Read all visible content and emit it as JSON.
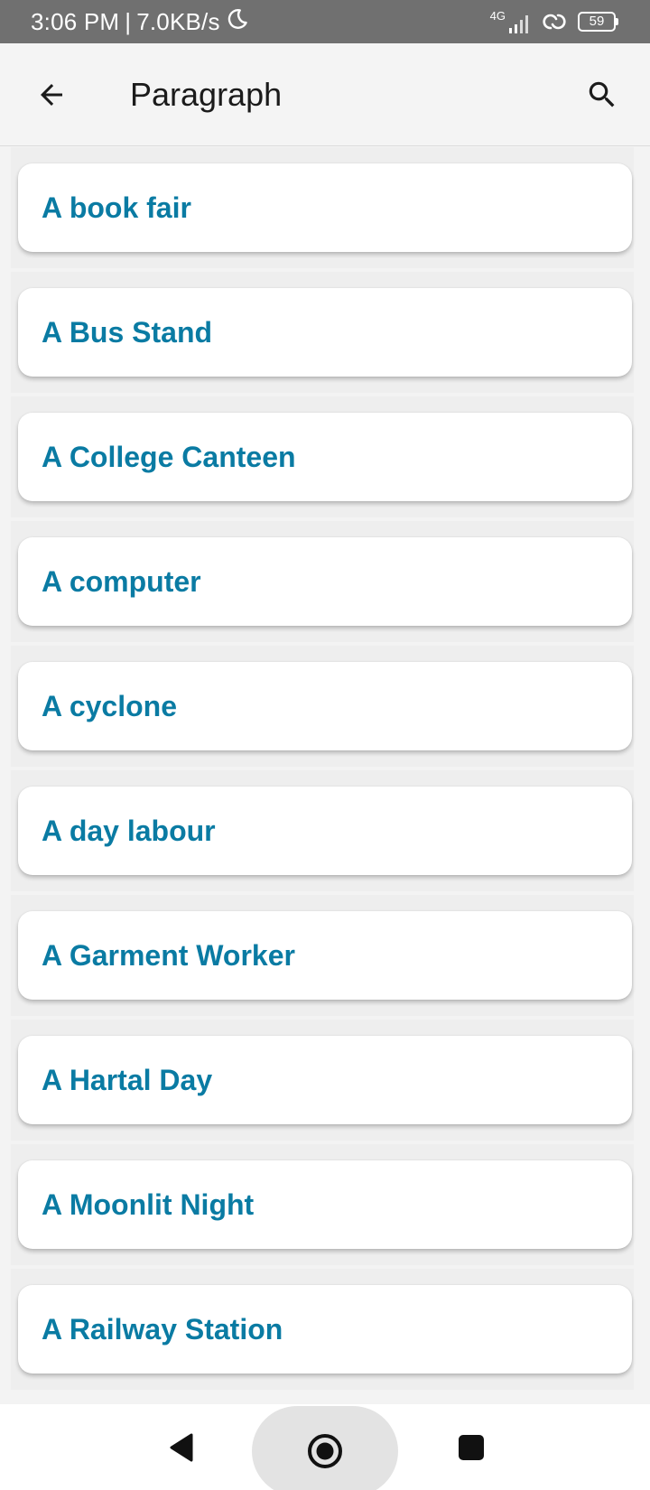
{
  "status_bar": {
    "time": "3:06 PM",
    "separator": "|",
    "network_speed": "7.0KB/s",
    "moon_icon": "moon-icon",
    "network_type": "4G",
    "signal_icon": "signal-bars-icon",
    "sync_icon": "link-icon",
    "battery_level": "59"
  },
  "app_bar": {
    "back_icon": "arrow-left-icon",
    "title": "Paragraph",
    "search_icon": "search-icon"
  },
  "list": {
    "items": [
      {
        "label": "A book fair"
      },
      {
        "label": "A Bus Stand"
      },
      {
        "label": "A College Canteen"
      },
      {
        "label": "A computer"
      },
      {
        "label": "A cyclone"
      },
      {
        "label": "A day labour"
      },
      {
        "label": "A Garment Worker"
      },
      {
        "label": "A Hartal Day"
      },
      {
        "label": "A Moonlit Night"
      },
      {
        "label": "A Railway Station"
      }
    ]
  },
  "nav_bar": {
    "back_icon": "triangle-back-icon",
    "home_icon": "circle-home-icon",
    "recent_icon": "square-recent-icon"
  },
  "colors": {
    "status_bar_bg": "#707070",
    "app_bar_bg": "#f4f4f4",
    "item_text": "#0a7ba3",
    "card_bg": "#ffffff",
    "page_bg": "#f3f3f3"
  }
}
